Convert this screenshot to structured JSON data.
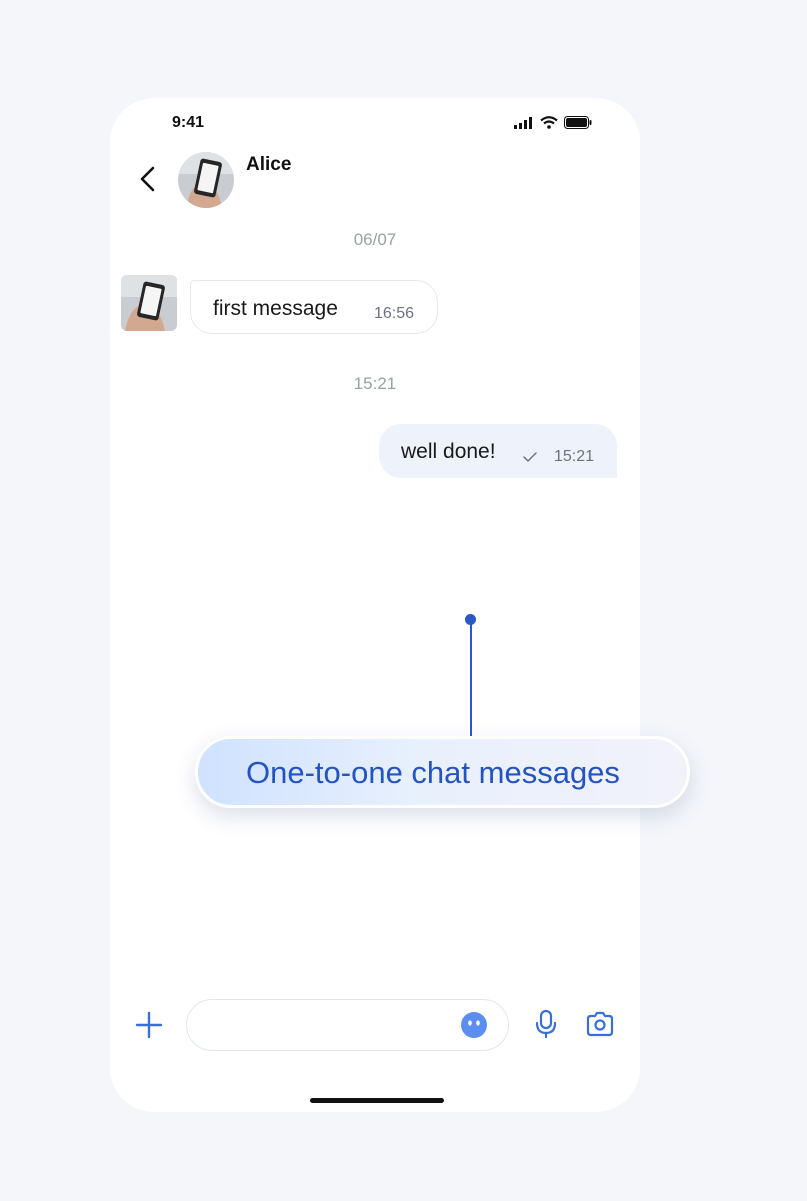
{
  "status_bar": {
    "time": "9:41"
  },
  "header": {
    "contact_name": "Alice"
  },
  "messages": {
    "date_separator_1": "06/07",
    "incoming": {
      "text": "first message",
      "time": "16:56"
    },
    "date_separator_2": "15:21",
    "outgoing": {
      "text": "well done!",
      "time": "15:21",
      "status": "sent"
    }
  },
  "callout": {
    "label": "One-to-one chat messages"
  },
  "composer": {
    "placeholder": ""
  },
  "colors": {
    "accent": "#2a58c8",
    "outgoing_bubble": "#eef3fb",
    "background": "#f4f6fa"
  }
}
